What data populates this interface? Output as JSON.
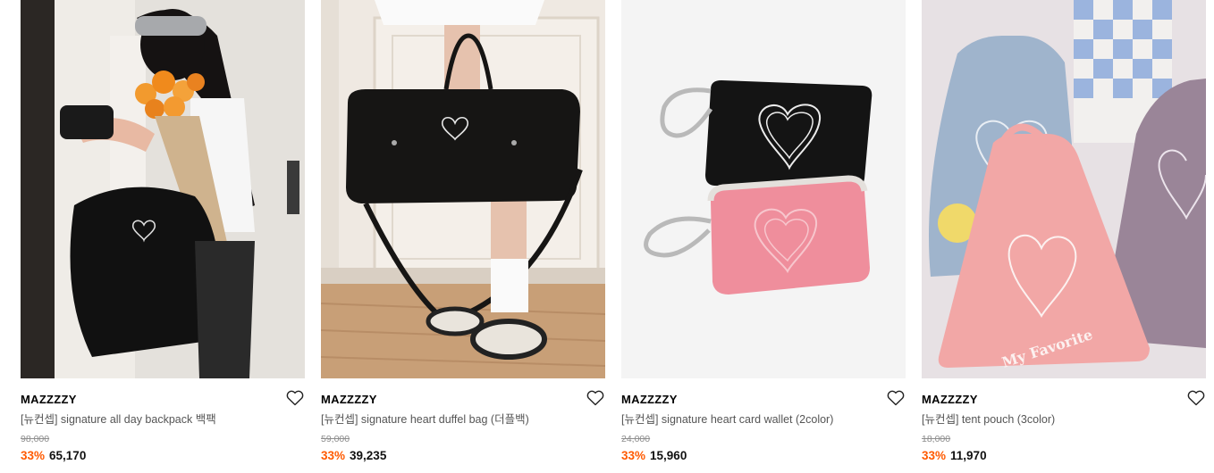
{
  "theme": {
    "discount_color": "#ff5a00"
  },
  "products": [
    {
      "brand": "MAZZZZY",
      "title": "[뉴컨셉] signature all day backpack 백팩",
      "original_price": "98,000",
      "discount": "33%",
      "price": "65,170",
      "wishlist_icon": "heart-outline-icon"
    },
    {
      "brand": "MAZZZZY",
      "title": "[뉴컨셉] signature heart duffel bag (더플백)",
      "original_price": "59,000",
      "discount": "33%",
      "price": "39,235",
      "wishlist_icon": "heart-outline-icon"
    },
    {
      "brand": "MAZZZZY",
      "title": "[뉴컨셉] signature heart card wallet (2color)",
      "original_price": "24,000",
      "discount": "33%",
      "price": "15,960",
      "wishlist_icon": "heart-outline-icon"
    },
    {
      "brand": "MAZZZZY",
      "title": "[뉴컨셉] tent pouch (3color)",
      "original_price": "18,000",
      "discount": "33%",
      "price": "11,970",
      "wishlist_icon": "heart-outline-icon",
      "image_text": "My Favorite"
    }
  ]
}
